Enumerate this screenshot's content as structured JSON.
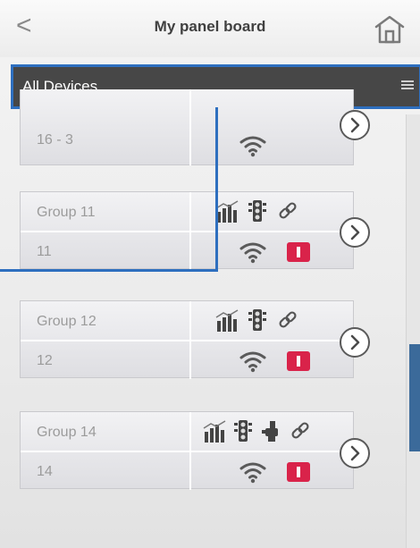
{
  "header": {
    "title": "My panel board"
  },
  "filter": {
    "label": "All Devices"
  },
  "devices": [
    {
      "name": "",
      "id": "16 - 3",
      "icons": [
        "wifi-icon"
      ],
      "alarm": false
    },
    {
      "name": "Group 11",
      "id": "11",
      "icons": [
        "chart-icon",
        "traffic-light-icon",
        "link-icon",
        "wifi-icon",
        "alarm-icon"
      ],
      "alarm": true
    },
    {
      "name": "Group 12",
      "id": "12",
      "icons": [
        "chart-icon",
        "traffic-light-icon",
        "link-icon",
        "wifi-icon",
        "alarm-icon"
      ],
      "alarm": true
    },
    {
      "name": "Group 14",
      "id": "14",
      "icons": [
        "chart-icon",
        "traffic-light-icon",
        "pump-icon",
        "link-icon",
        "wifi-icon",
        "alarm-icon"
      ],
      "alarm": true
    }
  ],
  "colors": {
    "accent": "#2e6fbf",
    "alarm": "#d9234a",
    "filterbar": "#474747",
    "scrollthumb": "#3b6a9a"
  }
}
